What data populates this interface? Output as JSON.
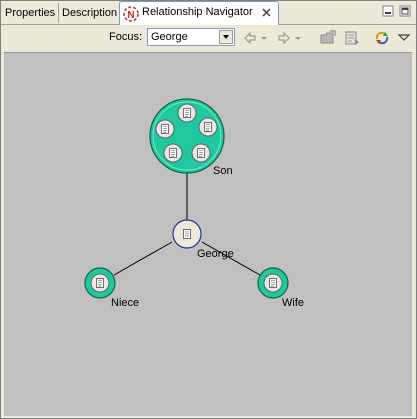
{
  "tabs": [
    {
      "label": "Properties"
    },
    {
      "label": "Description"
    },
    {
      "label": "Relationship Navigator",
      "active": true
    }
  ],
  "toolbar": {
    "focus_label": "Focus:",
    "focus_value": "George",
    "icons": [
      "back-arrow-icon",
      "back-dropdown-icon",
      "forward-arrow-icon",
      "forward-dropdown-icon",
      "open-folder-icon",
      "export-icon",
      "refresh-icon",
      "view-menu-icon"
    ]
  },
  "graph": {
    "nodes": [
      {
        "id": "son",
        "label": "Son",
        "members": 5
      },
      {
        "id": "george",
        "label": "George",
        "focus": true
      },
      {
        "id": "niece",
        "label": "Niece"
      },
      {
        "id": "wife",
        "label": "Wife"
      }
    ]
  },
  "colors": {
    "canvas": "#c0c0c0",
    "node_fill": "#20c8a0",
    "focus_fill": "#ece9d8",
    "focus_stroke": "#2030a0",
    "edge": "#000000"
  }
}
